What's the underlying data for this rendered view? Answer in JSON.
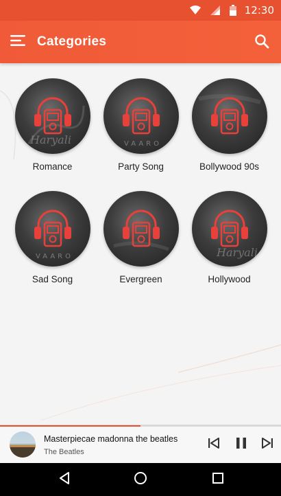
{
  "status_bar": {
    "time": "12:30"
  },
  "app_bar": {
    "title": "Categories"
  },
  "categories": [
    {
      "label": "Romance"
    },
    {
      "label": "Party Song"
    },
    {
      "label": "Bollywood 90s"
    },
    {
      "label": "Sad Song"
    },
    {
      "label": "Evergreen"
    },
    {
      "label": "Hollywood"
    }
  ],
  "now_playing": {
    "title": "Masterpiecae madonna the beatles",
    "artist": "The Beatles",
    "progress": 0.5
  },
  "colors": {
    "primary": "#f05a38",
    "status_bar": "#e8512f",
    "icon_ring": "#e8403a"
  },
  "icons": [
    "menu-icon",
    "search-icon",
    "wifi-icon",
    "signal-icon",
    "battery-icon",
    "headphones-music-icon",
    "skip-previous-icon",
    "pause-icon",
    "skip-next-icon",
    "back-icon",
    "home-icon",
    "recents-icon"
  ]
}
